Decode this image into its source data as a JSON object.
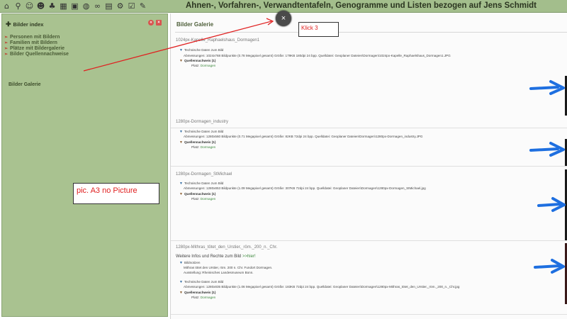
{
  "header": {
    "title": "Ahnen-, Vorfahren-, Verwandtentafeln, Genogramme und Listen bezogen auf Jens Schmidt",
    "toolbar_icons": [
      "home-icon",
      "search-icon",
      "person-icon",
      "people-icon",
      "tree-icon",
      "map-icon",
      "image-icon",
      "globe-icon",
      "glasses-icon",
      "document-icon",
      "settings-icon",
      "checklist-icon",
      "notes-icon"
    ]
  },
  "sidebar": {
    "title": "Bilder index",
    "items": [
      {
        "label": "Personen mit Bildern"
      },
      {
        "label": "Familien mit Bildern"
      },
      {
        "label": "Plätze mit Bildergalerie"
      },
      {
        "label": "Bilder Quellennachweise"
      }
    ],
    "active_item": "Bilder Galerie"
  },
  "main": {
    "title": "Bilder Galerie",
    "entries": [
      {
        "name": "1024px-Kapelle_Raphaelshaus_Dormagen1",
        "tech_label": "Technische Daten zum Bild",
        "tech_details": "Abmessungen: 1024x768 Bildpunkte  (0.78 Megapixel gesamt) Größe: 179KB 180dpi 24 bpp.  Quelldatei: Geoplaner Dateien\\Dormagen\\1024px-Kapelle_Raphaelshaus_Dormagen1.JPG",
        "source_label": "Quellennachweis (1)",
        "place_label": "Platz:",
        "place": "Dormagen"
      },
      {
        "name": "1280px-Dormagen_industry",
        "tech_label": "Technische Daten zum Bild",
        "tech_details": "Abmessungen: 1280x560 Bildpunkte  (0.71 Megapixel gesamt) Größe: 82KB 72dpi 24 bpp.  Quelldatei: Geoplaner Dateien\\Dormagen\\1280px-Dormagen_industry.JPG",
        "source_label": "Quellennachweis (1)",
        "place_label": "Platz:",
        "place": "Dormagen"
      },
      {
        "name": "1280px-Dormagen_StMichael",
        "tech_label": "Technische Daten zum Bild",
        "tech_details": "Abmessungen: 1280x853 Bildpunkte  (1.09 Megapixel gesamt) Größe: 307KB 72dpi 24 bpp.  Quelldatei: Geoplaner Dateien\\Dormagen\\1280px-Dormagen_StMichael.jpg",
        "source_label": "Quellennachweis (1)",
        "place_label": "Platz:",
        "place": "Dormagen"
      },
      {
        "name": "1280px-Mithras_tötet_den_Urstier,_röm._200_n._Chr.",
        "more_info_prefix": "Weitere Infos und Rechte zum Bild",
        "more_info_link": ">>hier!",
        "notes_label": "Bildnotizen",
        "notes_line1": "Mithras tötet den Urstier, röm. 200 n. Chr. Fundort Dormagen.",
        "notes_line2": "Ausstellung: Rheinisches Landesmuseum Bonn.",
        "tech_label": "Technische Daten zum Bild",
        "tech_details": "Abmessungen: 1280x835 Bildpunkte  (1.06 Megapixel gesamt) Größe: 183KB 72dpi 24 bpp.  Quelldatei: Geoplaner Dateien\\Dormagen\\1280px-Mithras_tötet_den_Urstier,_röm._200_n._Chr.jpg",
        "source_label": "Quellennachweis (1)",
        "place_label": "Platz:",
        "place": "Dormagen"
      }
    ]
  },
  "annotations": {
    "klick": "Klick 3",
    "no_picture": "pic. A3 no Picture",
    "close_glyph": "×"
  },
  "colors": {
    "green_bar": "#a3be8c",
    "sidebar": "#a9c290",
    "accent_red": "#e02020",
    "arrow_blue": "#1e6fe0"
  }
}
